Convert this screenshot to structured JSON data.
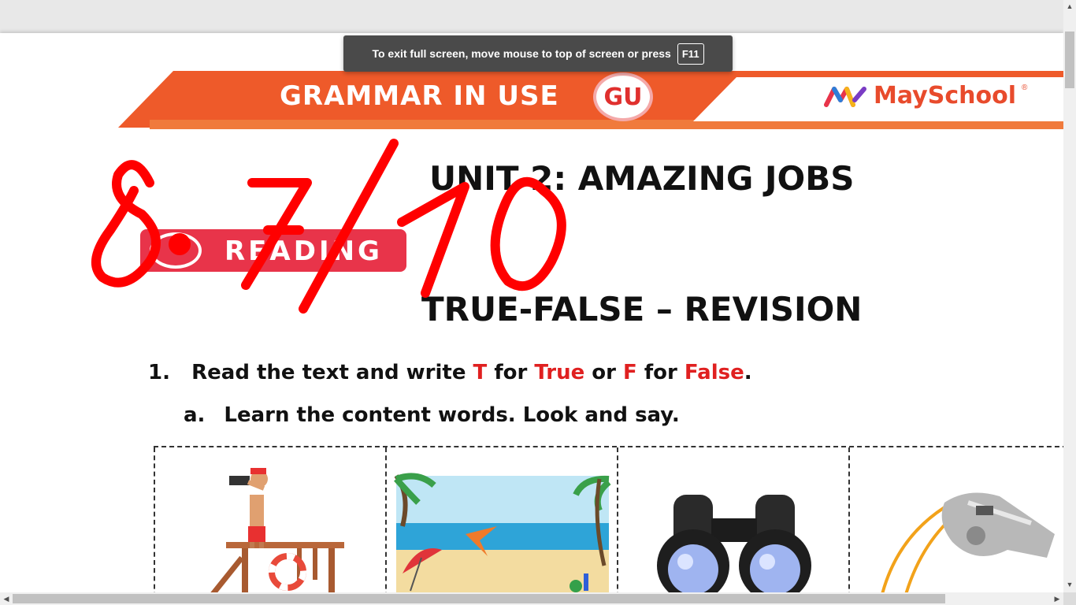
{
  "toast": {
    "message": "To exit full screen, move mouse to top of screen or press",
    "key": "F11"
  },
  "banner": {
    "title": "GRAMMAR IN USE",
    "gu_logo": "GU",
    "brand": "MaySchool",
    "brand_reg": "®"
  },
  "worksheet": {
    "unit_title": "UNIT 2: AMAZING JOBS",
    "reading_badge": "READING",
    "section_title": "TRUE-FALSE – REVISION",
    "question1": {
      "number": "1.",
      "text_start": "Read the text and write ",
      "t": "T",
      "for1": " for ",
      "true": "True",
      "or": " or ",
      "f": "F",
      "for2": " for ",
      "false": "False",
      "end": "."
    },
    "question_a": {
      "number": "a.",
      "text": "Learn the content words. Look and say."
    },
    "images": [
      "lifeguard-image",
      "beach-image",
      "binoculars-image",
      "whistle-image"
    ]
  },
  "annotation": {
    "score_text": "8.7/10",
    "color": "#ff0000"
  },
  "scrollbars": {
    "up_arrow": "▲",
    "down_arrow": "▼",
    "left_arrow": "◀",
    "right_arrow": "▶"
  }
}
